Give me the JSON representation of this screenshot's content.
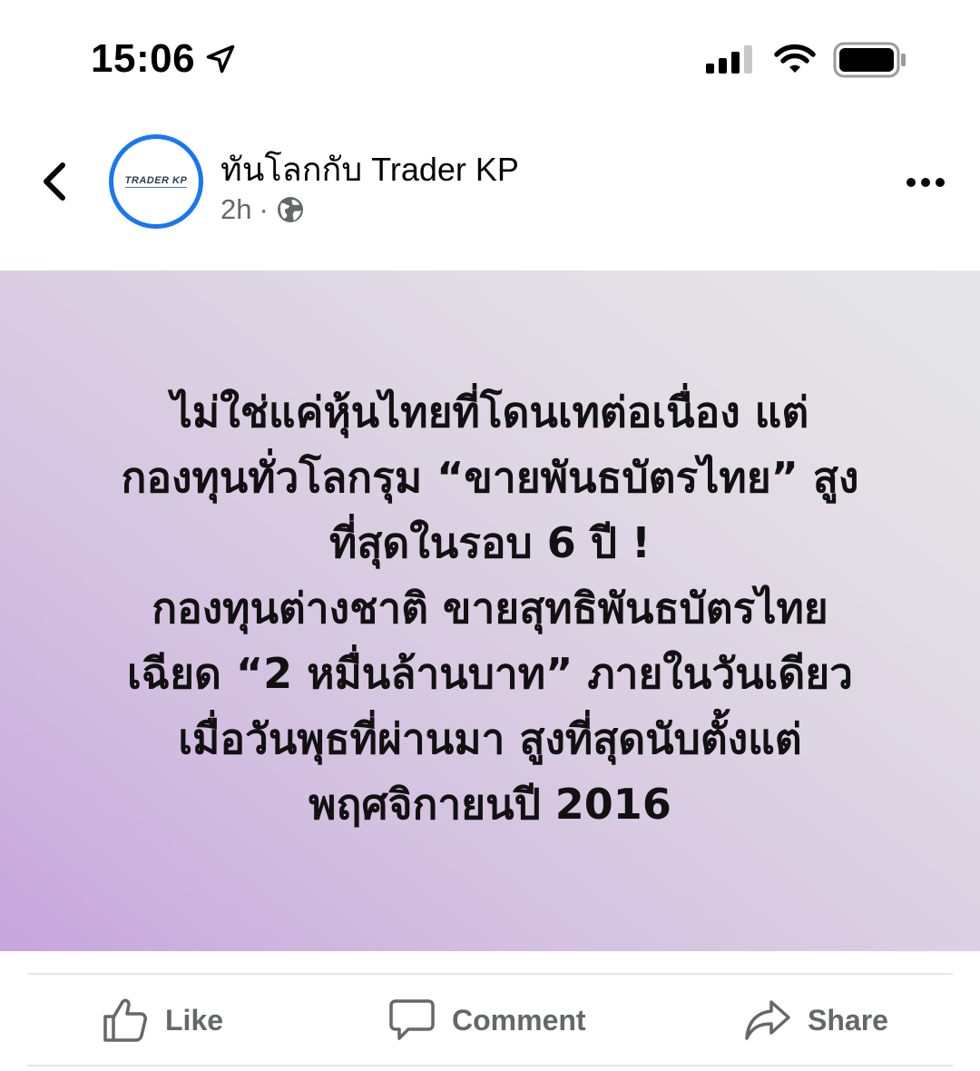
{
  "status_bar": {
    "time": "15:06",
    "icons": [
      "location-arrow-icon",
      "cellular-signal-icon",
      "wifi-icon",
      "battery-icon"
    ]
  },
  "header": {
    "back_icon": "chevron-left-icon",
    "avatar_logo_text": "TRADER KP",
    "page_name": "ทันโลกกับ Trader KP",
    "time_ago": "2h",
    "separator": "·",
    "audience_icon": "globe-icon",
    "more_icon": "ellipsis-icon"
  },
  "post": {
    "background_colors": [
      "#c6a6dd",
      "#e6e6e8"
    ],
    "lines": [
      "ไม่ใช่แค่หุ้นไทยที่โดนเทต่อเนื่อง แต่",
      "กองทุนทั่วโลกรุม “ขายพันธบัตรไทย” สูง",
      "ที่สุดในรอบ 6 ปี !",
      "กองทุนต่างชาติ ขายสุทธิพันธบัตรไทย",
      "เฉียด “2 หมื่นล้านบาท” ภายในวันเดียว",
      "เมื่อวันพุธที่ผ่านมา สูงที่สุดนับตั้งแต่",
      "พฤศจิกายนปี 2016"
    ]
  },
  "actions": {
    "like_label": "Like",
    "comment_label": "Comment",
    "share_label": "Share",
    "color": "#65676b"
  }
}
